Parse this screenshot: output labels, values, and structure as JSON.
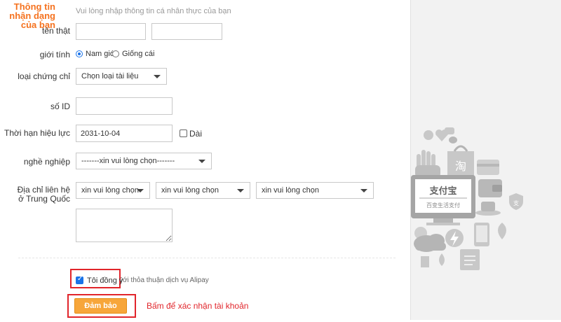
{
  "header": {
    "title": "Thông tin nhận dạng của bạn",
    "subtitle": "Vui lòng nhập thông tin cá nhân thực của bạn"
  },
  "form": {
    "real_name_label": "tên thật",
    "gender_label": "giới tính",
    "gender_options": [
      "Nam giới",
      "Giống cái"
    ],
    "gender_selected": "Nam giới",
    "cert_type_label": "loại chứng chỉ",
    "cert_type_value": "Chọn loại tài liệu",
    "id_label": "số ID",
    "validity_label": "Thời hạn hiệu lực",
    "validity_value": "2031-10-04",
    "long_term_label": "Dài",
    "job_label": "nghề nghiệp",
    "job_value": "-------xin vui lòng chọn-------",
    "address_label": "Địa chỉ liên hệ ở Trung Quốc",
    "address_selects": [
      "xin vui lòng chọn",
      "xin vui lòng chọn",
      "xin vui lòng chọn"
    ]
  },
  "agreement": {
    "checked": true,
    "label": "Tôi đồng ý",
    "text": "với thỏa thuận dịch vụ Alipay"
  },
  "actions": {
    "confirm_label": "Đảm bảo",
    "annotation": "Bấm để xác nhận tài khoản"
  },
  "side": {
    "logo_text": "支付宝",
    "logo_subtitle": "百变生活支付",
    "taobao_char": "淘",
    "colors": {
      "icon_gray": "#c8c8c8",
      "icon_dark": "#a5a5a5",
      "accent": "#f5721f",
      "highlight": "#e1252b"
    }
  }
}
